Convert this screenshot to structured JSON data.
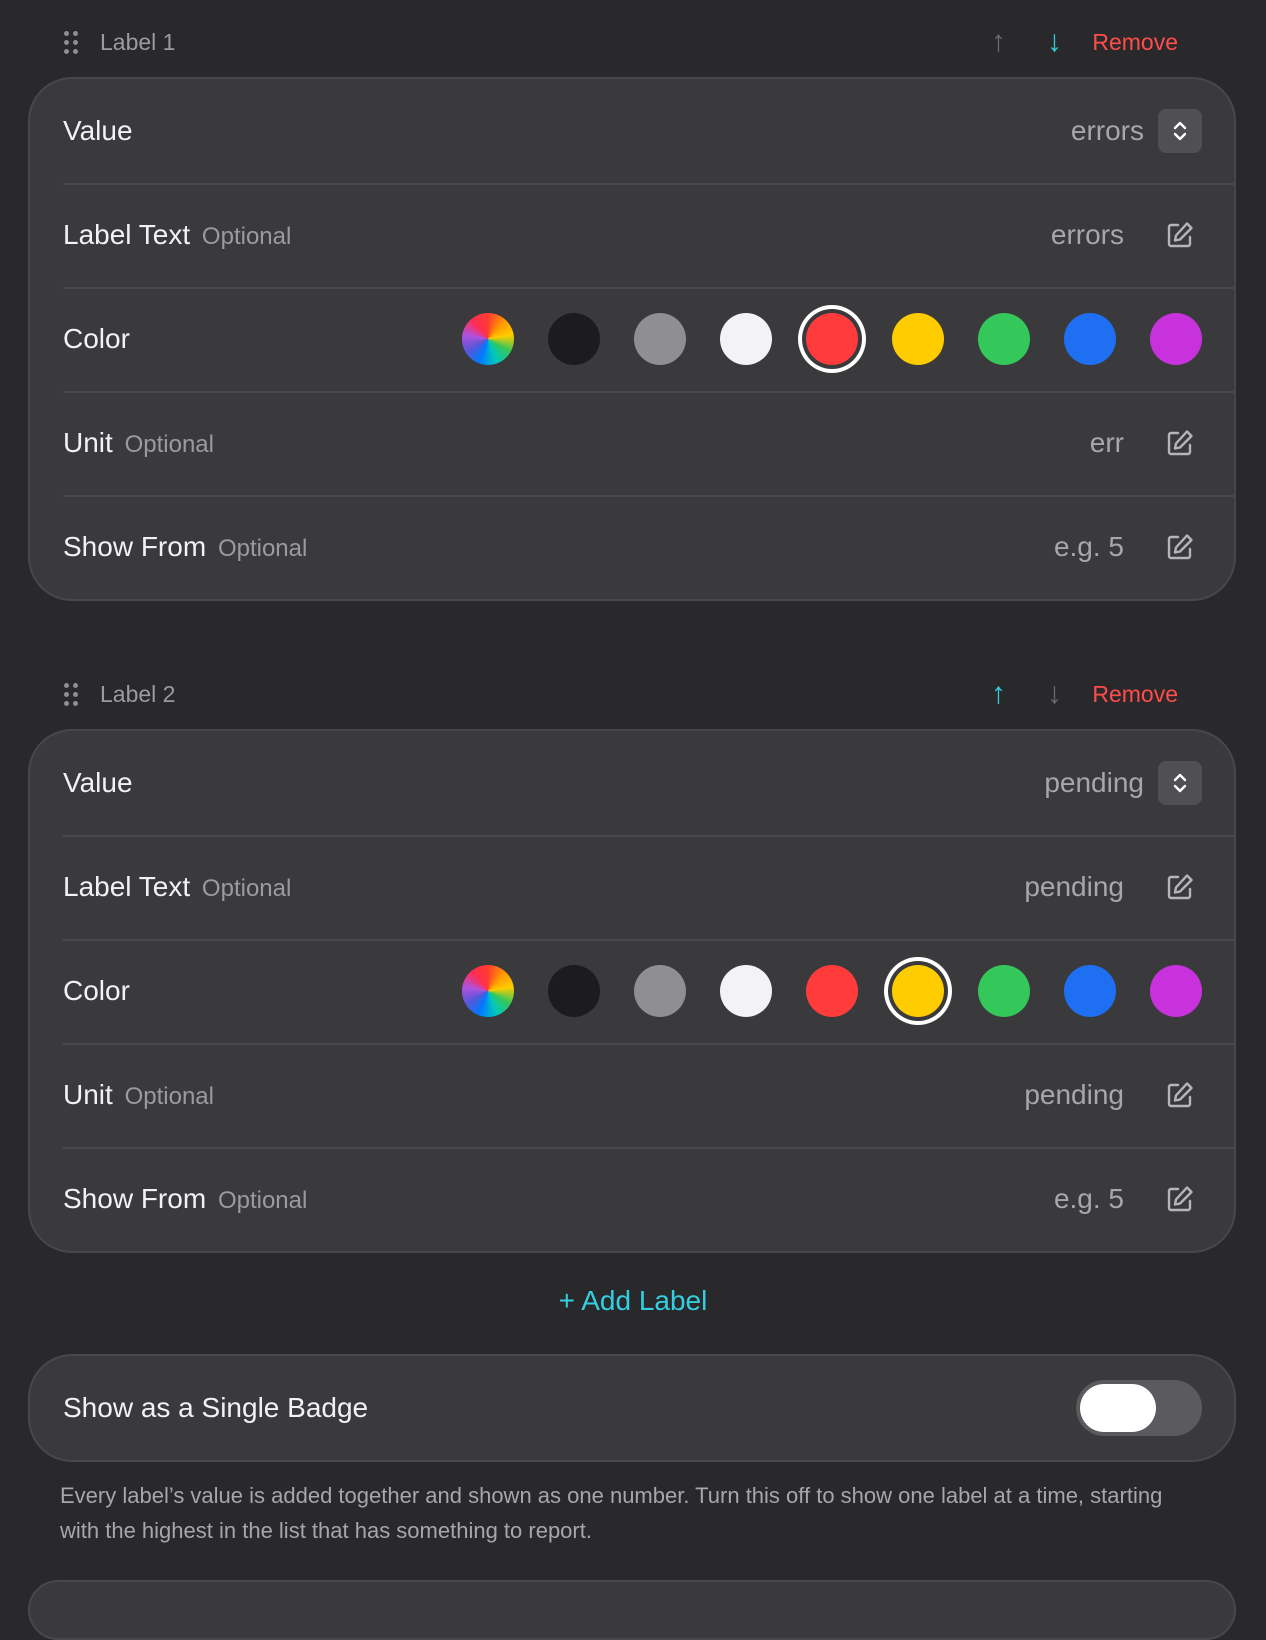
{
  "labels": [
    {
      "header": "Label 1",
      "remove": "Remove",
      "up_active": false,
      "down_active": true,
      "value": {
        "label": "Value",
        "value": "errors"
      },
      "label_text": {
        "label": "Label Text",
        "optional": "Optional",
        "value": "errors"
      },
      "color": {
        "label": "Color",
        "selected": "red"
      },
      "unit": {
        "label": "Unit",
        "optional": "Optional",
        "value": "err"
      },
      "show_from": {
        "label": "Show From",
        "optional": "Optional",
        "placeholder": "e.g. 5"
      }
    },
    {
      "header": "Label 2",
      "remove": "Remove",
      "up_active": true,
      "down_active": false,
      "value": {
        "label": "Value",
        "value": "pending"
      },
      "label_text": {
        "label": "Label Text",
        "optional": "Optional",
        "value": "pending"
      },
      "color": {
        "label": "Color",
        "selected": "yellow"
      },
      "unit": {
        "label": "Unit",
        "optional": "Optional",
        "value": "pending"
      },
      "show_from": {
        "label": "Show From",
        "optional": "Optional",
        "placeholder": "e.g. 5"
      }
    }
  ],
  "swatch_colors": {
    "black": "#1c1c1e",
    "gray": "#8e8e93",
    "white": "#f2f2f7",
    "red": "#ff3b3b",
    "yellow": "#ffcc00",
    "green": "#34c759",
    "blue": "#1f6ff2",
    "purple": "#c832dc"
  },
  "add_label": "+ Add Label",
  "single_badge": {
    "label": "Show as a Single Badge",
    "on": false
  },
  "footnote": "Every label’s value is added together and shown as one number. Turn this off to show one label at a time, starting with the highest in the list that has something to report.",
  "icons": {
    "grip": "grip-dots-icon",
    "up": "↑",
    "down": "↓",
    "stepper": "chevron-up-down-icon",
    "edit": "edit-icon"
  }
}
